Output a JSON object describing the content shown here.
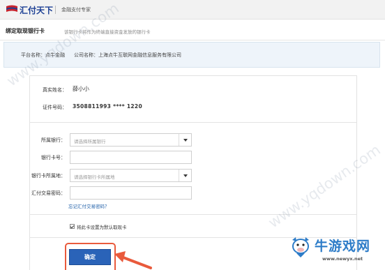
{
  "header": {
    "brand": "汇付天下",
    "slogan": "金融支付专家"
  },
  "page": {
    "title": "绑定取现银行卡",
    "description": "该银行卡将作为终端直接资金发放的银行卡"
  },
  "info": {
    "platform": "平台名称：点牛金融",
    "company": "公司名称：上海点牛互联网金融信息服务有限公司"
  },
  "identity": {
    "name_label": "真实姓名：",
    "name_value": "薛小小",
    "id_label": "证件号码：",
    "id_value": "3508811993 **** 1220"
  },
  "form": {
    "bank_label": "所属银行：",
    "bank_placeholder": "请选择所属银行",
    "card_label": "银行卡号：",
    "card_value": "",
    "region_label": "银行卡所属地：",
    "region_placeholder": "请选择银行卡所属地",
    "password_label": "汇付交易密码：",
    "password_value": "",
    "forgot_link": "忘记汇付交易密码？",
    "default_checkbox_label": "将此卡设置为默认取现卡",
    "default_checked": true,
    "confirm_button": "确定"
  },
  "watermark": {
    "text": "www.yqdown.com"
  },
  "site_brand": {
    "name": "牛游戏网",
    "url": "www.newyx.net"
  },
  "colors": {
    "accent": "#2a63b8",
    "brand_blue": "#1c3f94",
    "highlight_red": "#e95a3c",
    "info_bg": "#eef4fa"
  }
}
